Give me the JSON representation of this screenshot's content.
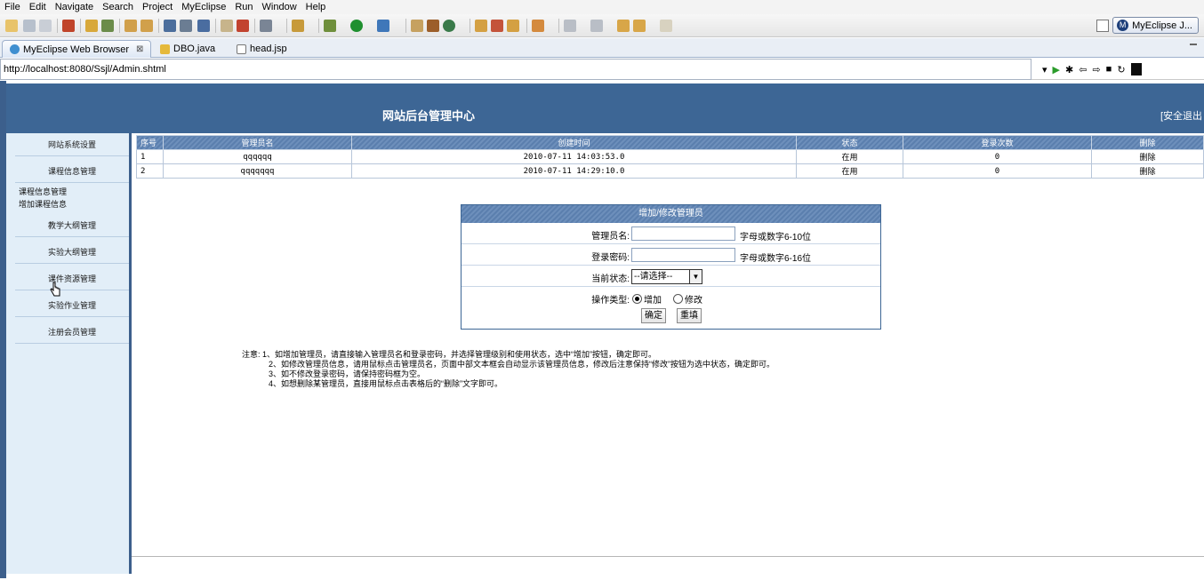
{
  "menu": [
    "File",
    "Edit",
    "Navigate",
    "Search",
    "Project",
    "MyEclipse",
    "Run",
    "Window",
    "Help"
  ],
  "perspective": {
    "label": "MyEclipse J..."
  },
  "tabs": [
    {
      "label": "MyEclipse Web Browser",
      "close": "⊠"
    },
    {
      "label": "DBO.java"
    },
    {
      "label": "head.jsp"
    }
  ],
  "address": "http://localhost:8080/Ssjl/Admin.shtml",
  "site": {
    "title": "网站后台管理中心",
    "logout": "[安全退出"
  },
  "sidebar": {
    "items": [
      "网站系统设置",
      "课程信息管理"
    ],
    "subitems": [
      "课程信息管理",
      "增加课程信息"
    ],
    "items2": [
      "教学大纲管理",
      "实验大纲管理",
      "课件资源管理",
      "实验作业管理",
      "注册会员管理"
    ]
  },
  "table": {
    "headers": [
      "序号",
      "管理员名",
      "创建时间",
      "状态",
      "登录次数",
      "删除"
    ],
    "rows": [
      [
        "1",
        "qqqqqq",
        "2010-07-11 14:03:53.0",
        "在用",
        "0",
        "删除"
      ],
      [
        "2",
        "qqqqqqq",
        "2010-07-11 14:29:10.0",
        "在用",
        "0",
        "删除"
      ]
    ]
  },
  "form": {
    "title": "增加/修改管理员",
    "name_label": "管理员名:",
    "name_hint": "字母或数字6-10位",
    "pwd_label": "登录密码:",
    "pwd_hint": "字母或数字6-16位",
    "status_label": "当前状态:",
    "status_value": "--请选择--",
    "type_label": "操作类型:",
    "type_add": "增加",
    "type_edit": "修改",
    "confirm": "确定",
    "reset": "重填"
  },
  "notes": [
    "注意: 1、如增加管理员，请直接输入管理员名和登录密码，并选择管理级别和使用状态，选中“增加”按钮，确定即可。",
    "2、如修改管理员信息，请用鼠标点击管理员名，页面中部文本框会自动显示该管理员信息，修改后注意保持“修改”按钮为选中状态，确定即可。",
    "3、如不修改登录密码，请保持密码框为空。",
    "4、如想删除某管理员，直接用鼠标点击表格后的“删除”文字即可。"
  ],
  "colors": {
    "header": "#3d6695",
    "sidebar": "#e2eef8",
    "table_head": "#5b7fae"
  }
}
